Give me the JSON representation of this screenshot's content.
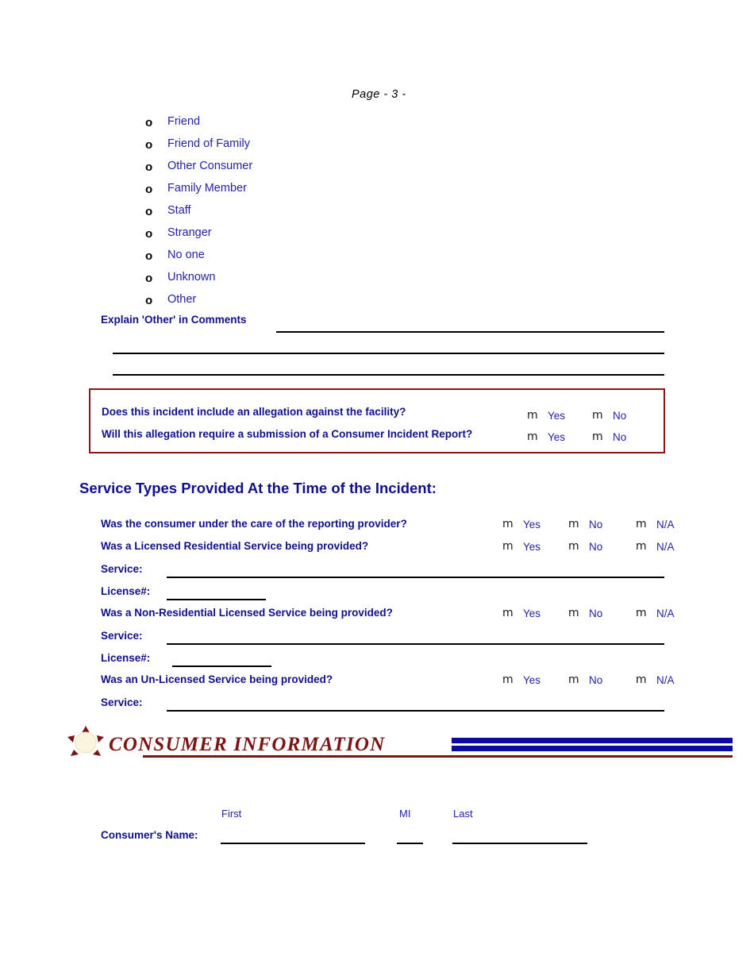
{
  "page": {
    "header_label": "Page  - 3 -"
  },
  "reporter_options": {
    "bullet_glyph": "o",
    "items": [
      {
        "label": "Friend"
      },
      {
        "label": "Friend of Family"
      },
      {
        "label": "Other Consumer"
      },
      {
        "label": "Family Member"
      },
      {
        "label": "Staff"
      },
      {
        "label": "Stranger"
      },
      {
        "label": "No one"
      },
      {
        "label": "Unknown"
      },
      {
        "label": "Other"
      }
    ]
  },
  "explain_other": {
    "label": "Explain 'Other' in Comments"
  },
  "allegation_box": {
    "border_color": "#8c1515",
    "rows": [
      {
        "question": "Does this incident include an allegation against the facility?",
        "choices": [
          {
            "glyph": "m",
            "label": "Yes"
          },
          {
            "glyph": "m",
            "label": "No"
          }
        ]
      },
      {
        "question": "Will this allegation require a submission of a Consumer Incident Report?",
        "choices": [
          {
            "glyph": "m",
            "label": "Yes"
          },
          {
            "glyph": "m",
            "label": "No"
          }
        ]
      }
    ]
  },
  "service_types": {
    "heading": "Service Types Provided At the Time of the Incident:",
    "q1": {
      "question": "Was the consumer under the care of the reporting provider?",
      "choices": [
        {
          "glyph": "m",
          "label": "Yes"
        },
        {
          "glyph": "m",
          "label": "No"
        },
        {
          "glyph": "m",
          "label": "N/A"
        }
      ]
    },
    "q2": {
      "question": "Was a Licensed Residential Service being provided?",
      "choices": [
        {
          "glyph": "m",
          "label": "Yes"
        },
        {
          "glyph": "m",
          "label": "No"
        },
        {
          "glyph": "m",
          "label": "N/A"
        }
      ],
      "service_label": "Service:",
      "service_value": "",
      "license_label": "License#:",
      "license_value": ""
    },
    "q3": {
      "question": "Was a Non-Residential Licensed Service being provided?",
      "choices": [
        {
          "glyph": "m",
          "label": "Yes"
        },
        {
          "glyph": "m",
          "label": "No"
        },
        {
          "glyph": "m",
          "label": "N/A"
        }
      ],
      "service_label": "Service:",
      "service_value": "",
      "license_label": "License#:",
      "license_value": ""
    },
    "q4": {
      "question": "Was an Un-Licensed Service being provided?",
      "choices": [
        {
          "glyph": "m",
          "label": "Yes"
        },
        {
          "glyph": "m",
          "label": "No"
        },
        {
          "glyph": "m",
          "label": "N/A"
        }
      ],
      "service_label": "Service:",
      "service_value": ""
    }
  },
  "consumer_banner": {
    "title": "CONSUMER INFORMATION",
    "accent_red": "#7d1414",
    "accent_navy": "#0b0b9e",
    "star_fill": "#faf6dc"
  },
  "consumer_name": {
    "row_label": "Consumer's Name:",
    "first_label": "First",
    "first_value": "",
    "mi_label": "MI",
    "mi_value": "",
    "last_label": "Last",
    "last_value": ""
  }
}
